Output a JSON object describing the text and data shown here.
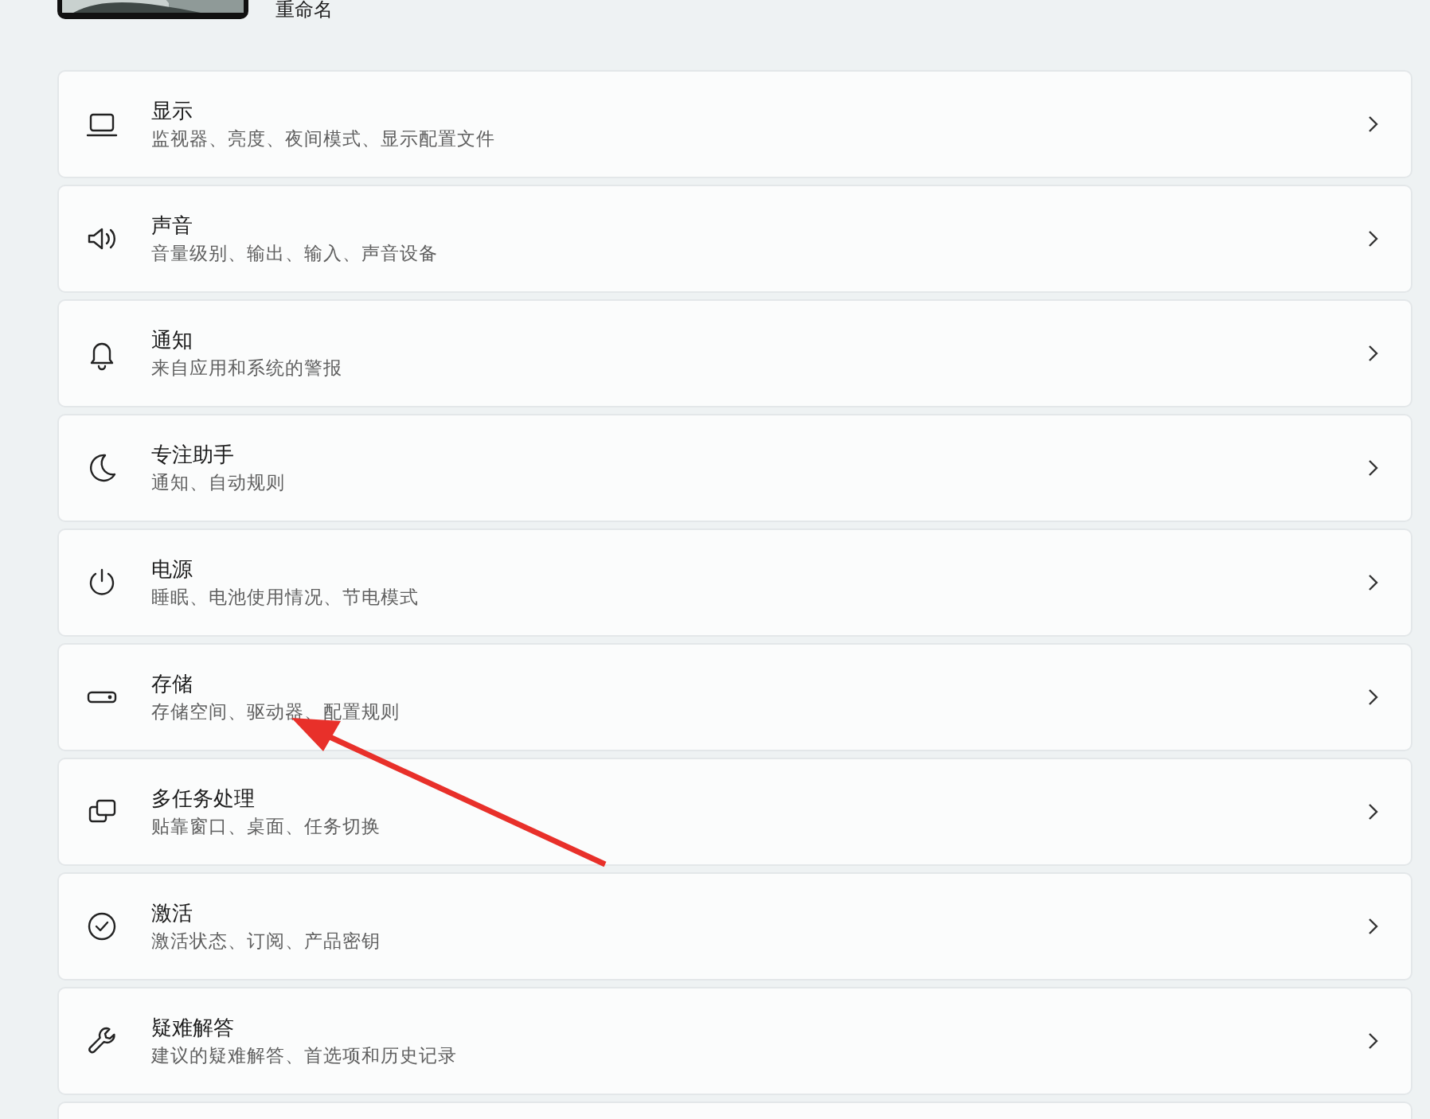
{
  "device": {
    "rename_link": "重命名"
  },
  "settings": [
    {
      "title": "显示",
      "subtitle": "监视器、亮度、夜间模式、显示配置文件"
    },
    {
      "title": "声音",
      "subtitle": "音量级别、输出、输入、声音设备"
    },
    {
      "title": "通知",
      "subtitle": "来自应用和系统的警报"
    },
    {
      "title": "专注助手",
      "subtitle": "通知、自动规则"
    },
    {
      "title": "电源",
      "subtitle": "睡眠、电池使用情况、节电模式"
    },
    {
      "title": "存储",
      "subtitle": "存储空间、驱动器、配置规则"
    },
    {
      "title": "多任务处理",
      "subtitle": "贴靠窗口、桌面、任务切换"
    },
    {
      "title": "激活",
      "subtitle": "激活状态、订阅、产品密钥"
    },
    {
      "title": "疑难解答",
      "subtitle": "建议的疑难解答、首选项和历史记录"
    }
  ],
  "annotation": {
    "kind": "arrow"
  }
}
